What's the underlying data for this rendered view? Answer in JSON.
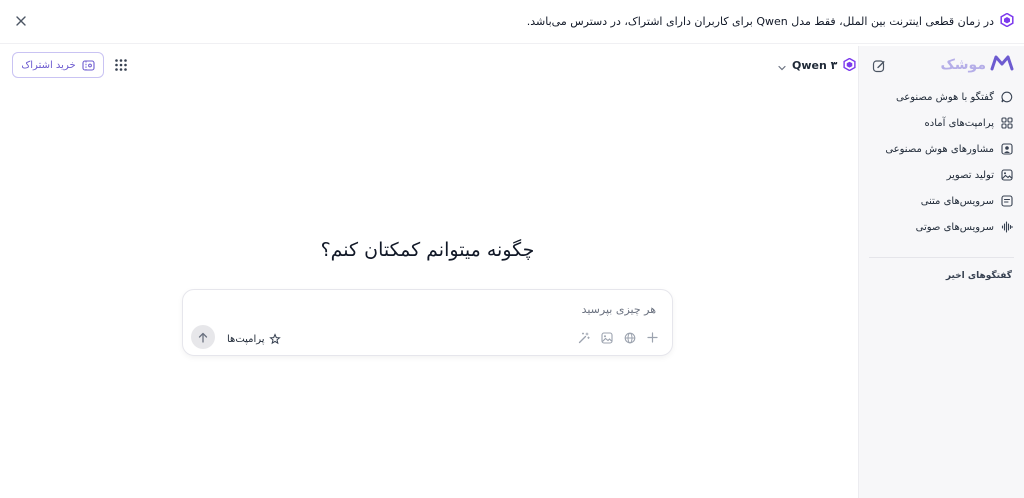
{
  "banner": {
    "text": "در زمان قطعی اینترنت بین الملل، فقط مدل Qwen برای کاربران دارای اشتراک، در دسترس می‌باشد.",
    "close_icon": "close-icon",
    "brand_icon": "qwen-logo-icon"
  },
  "sidebar": {
    "logo_text": "موشک",
    "new_chat_icon": "edit-icon",
    "items": [
      {
        "label": "گفتگو با هوش مصنوعی",
        "icon": "chat-bubble-icon"
      },
      {
        "label": "پرامپت‌های آماده",
        "icon": "grid-icon"
      },
      {
        "label": "مشاورهای هوش مصنوعی",
        "icon": "advisor-icon"
      },
      {
        "label": "تولید تصویر",
        "icon": "image-icon"
      },
      {
        "label": "سرویس‌های متنی",
        "icon": "text-doc-icon"
      },
      {
        "label": "سرویس‌های صوتی",
        "icon": "audio-wave-icon"
      }
    ],
    "recent_heading": "گفتگوهای اخیر"
  },
  "header": {
    "subscribe_label": "خرید اشتراک",
    "model_label": "Qwen ۳",
    "apps_icon": "apps-grid-icon"
  },
  "main": {
    "headline": "چگونه میتوانم کمکتان کنم؟",
    "input_placeholder": "هر چیزی بپرسید",
    "input_value": "",
    "prompts_label": "پرامپت‌ها",
    "tools": [
      "plus-icon",
      "globe-icon",
      "image-icon",
      "magic-wand-icon"
    ]
  },
  "colors": {
    "accent": "#6d5bd0",
    "accent_light": "#b5aee8",
    "sidebar_bg": "#f7f7f9"
  }
}
